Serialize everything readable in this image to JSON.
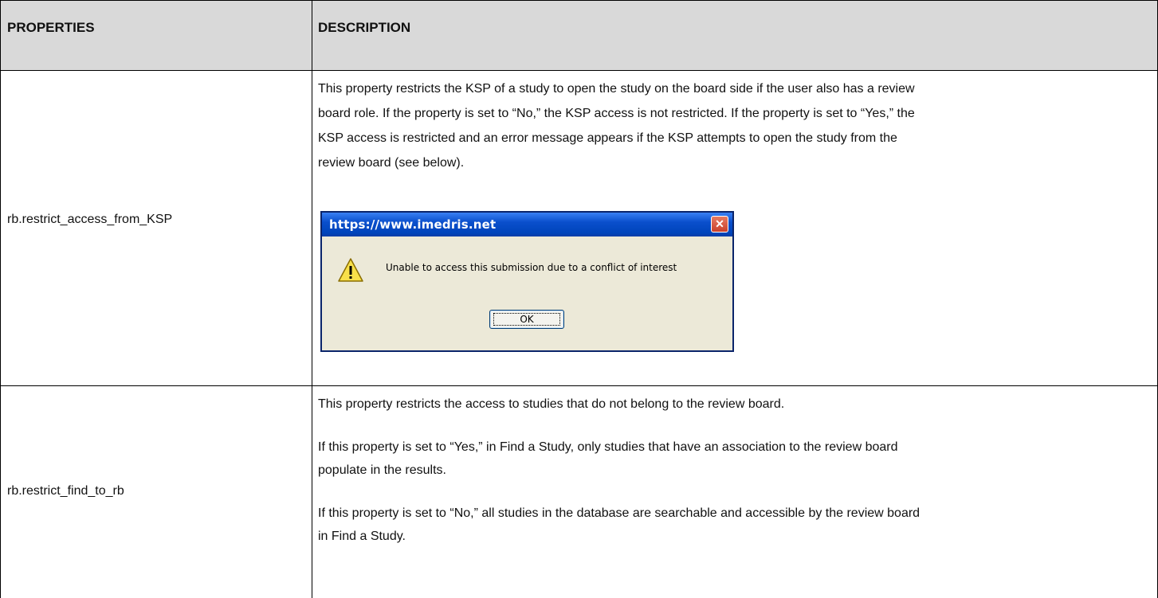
{
  "header": {
    "properties_label": "PROPERTIES",
    "description_label": "DESCRIPTION"
  },
  "rows": [
    {
      "property": "rb.restrict_access_from_KSP",
      "description_lines": [
        "This property restricts the KSP of a study to open the study on the board side if the user also has a review",
        "board role. If the property is set to “No,” the KSP access is not restricted. If the property is set to “Yes,” the",
        "KSP access is restricted and an error message appears if the KSP attempts to open the study from the",
        "review board (see below)."
      ],
      "dialog": {
        "title": "https://www.imedris.net",
        "close_glyph": "✕",
        "message": "Unable to access this submission due to a conflict of interest",
        "ok_label": "OK",
        "icon": "warning-icon"
      }
    },
    {
      "property": "rb.restrict_find_to_rb",
      "description_lines": [
        "This property restricts the access to studies that do not belong to the review board.",
        "If this property is set to “Yes,” in Find a Study, only studies that have an association to the review board",
        "populate in the results.",
        "If this property is set to “No,” all studies in the database are searchable and accessible by the review board",
        "in Find a Study."
      ]
    }
  ],
  "colors": {
    "header_bg": "#d9d9d9",
    "border": "#000000",
    "dialog_title_bg": "#0a4fcc",
    "dialog_body_bg": "#ece9d8"
  }
}
